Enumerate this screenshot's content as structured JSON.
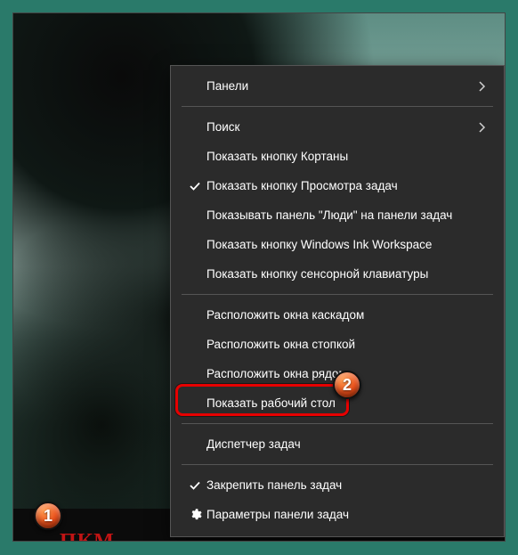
{
  "menu": {
    "items": [
      {
        "label": "Панели",
        "submenu": true
      },
      {
        "divider": true
      },
      {
        "label": "Поиск",
        "submenu": true
      },
      {
        "label": "Показать кнопку Кортаны"
      },
      {
        "label": "Показать кнопку Просмотра задач",
        "checked": true
      },
      {
        "label": "Показывать панель \"Люди\" на панели задач"
      },
      {
        "label": "Показать кнопку Windows Ink Workspace"
      },
      {
        "label": "Показать кнопку сенсорной клавиатуры"
      },
      {
        "divider": true
      },
      {
        "label": "Расположить окна каскадом"
      },
      {
        "label": "Расположить окна стопкой"
      },
      {
        "label": "Расположить окна рядом"
      },
      {
        "label": "Показать рабочий стол"
      },
      {
        "divider": true
      },
      {
        "label": "Диспетчер задач"
      },
      {
        "divider": true
      },
      {
        "label": "Закрепить панель задач",
        "checked": true
      },
      {
        "label": "Параметры панели задач",
        "icon": "gear"
      }
    ]
  },
  "annotations": {
    "badge1": "1",
    "badge2": "2",
    "pkm": "ПКМ"
  }
}
